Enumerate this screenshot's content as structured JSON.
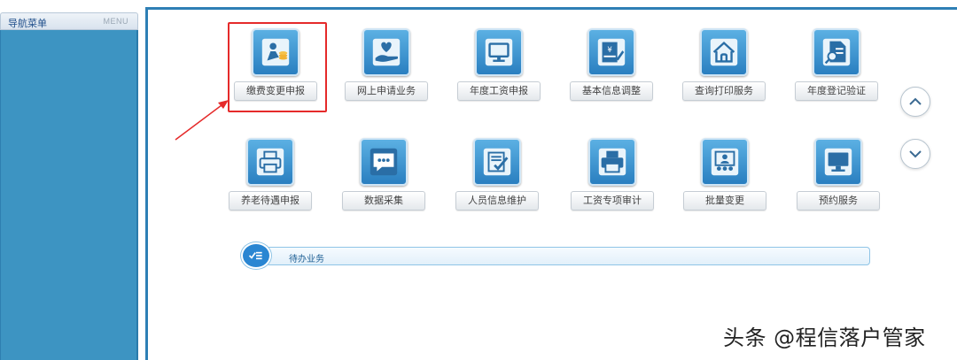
{
  "sidebar": {
    "title": "导航菜单",
    "menu_tag": "MENU"
  },
  "tiles_row1": [
    {
      "label": "缴费变更申报",
      "icon": "person-coins-icon"
    },
    {
      "label": "网上申请业务",
      "icon": "heart-hand-icon"
    },
    {
      "label": "年度工资申报",
      "icon": "monitor-icon"
    },
    {
      "label": "基本信息调整",
      "icon": "yen-card-icon"
    },
    {
      "label": "查询打印服务",
      "icon": "house-icon"
    },
    {
      "label": "年度登记验证",
      "icon": "document-search-icon"
    }
  ],
  "tiles_row2": [
    {
      "label": "养老待遇申报",
      "icon": "printer-icon"
    },
    {
      "label": "数据采集",
      "icon": "chat-bubble-icon"
    },
    {
      "label": "人员信息维护",
      "icon": "edit-document-icon"
    },
    {
      "label": "工资专项审计",
      "icon": "printer-icon"
    },
    {
      "label": "批量变更",
      "icon": "presentation-icon"
    },
    {
      "label": "预约服务",
      "icon": "monitor-icon"
    }
  ],
  "pending": {
    "label": "待办业务"
  },
  "watermark": "头条 @程信落户管家",
  "colors": {
    "sidebar": "#3d94c2",
    "frame": "#2e7fb5",
    "tile_icon": "#2a7fc0",
    "highlight": "#e52a2a"
  }
}
